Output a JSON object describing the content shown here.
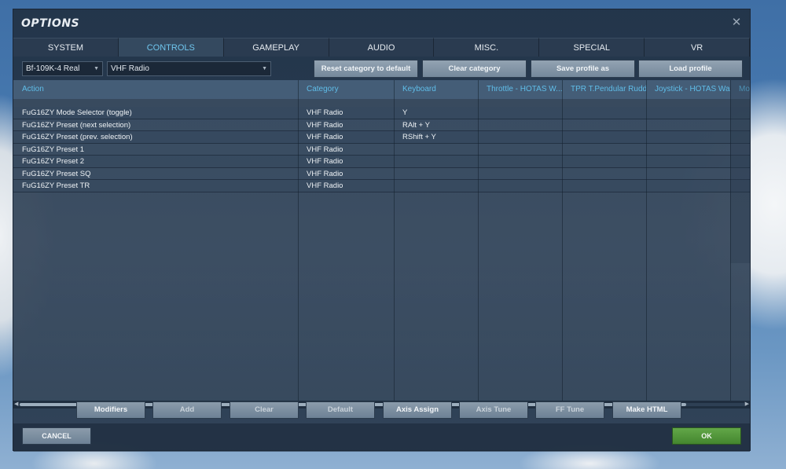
{
  "window": {
    "title": "OPTIONS"
  },
  "tabs": [
    {
      "label": "SYSTEM"
    },
    {
      "label": "CONTROLS",
      "active": true
    },
    {
      "label": "GAMEPLAY"
    },
    {
      "label": "AUDIO"
    },
    {
      "label": "MISC."
    },
    {
      "label": "SPECIAL"
    },
    {
      "label": "VR"
    }
  ],
  "toolbar": {
    "aircraft": "Bf-109K-4 Real",
    "category": "VHF Radio",
    "reset_label": "Reset category to default",
    "clear_label": "Clear category",
    "save_label": "Save profile as",
    "load_label": "Load profile"
  },
  "table": {
    "columns": [
      "Action",
      "Category",
      "Keyboard",
      "Throttle - HOTAS W...",
      "TPR T.Pendular Rudd...",
      "Joystick - HOTAS Wa...",
      "Mo"
    ],
    "rows": [
      {
        "action": "FuG16ZY Mode Selector (toggle)",
        "category": "VHF Radio",
        "keyboard": "Y"
      },
      {
        "action": "FuG16ZY Preset (next selection)",
        "category": "VHF Radio",
        "keyboard": "RAlt + Y"
      },
      {
        "action": "FuG16ZY Preset (prev. selection)",
        "category": "VHF Radio",
        "keyboard": "RShift + Y"
      },
      {
        "action": "FuG16ZY Preset 1",
        "category": "VHF Radio",
        "keyboard": ""
      },
      {
        "action": "FuG16ZY Preset 2",
        "category": "VHF Radio",
        "keyboard": ""
      },
      {
        "action": "FuG16ZY Preset SQ",
        "category": "VHF Radio",
        "keyboard": ""
      },
      {
        "action": "FuG16ZY Preset TR",
        "category": "VHF Radio",
        "keyboard": ""
      }
    ]
  },
  "bottom_buttons": {
    "modifiers": "Modifiers",
    "add": "Add",
    "clear": "Clear",
    "default": "Default",
    "axis_assign": "Axis Assign",
    "axis_tune": "Axis Tune",
    "ff_tune": "FF Tune",
    "make_html": "Make HTML"
  },
  "footer": {
    "cancel": "CANCEL",
    "ok": "OK"
  }
}
